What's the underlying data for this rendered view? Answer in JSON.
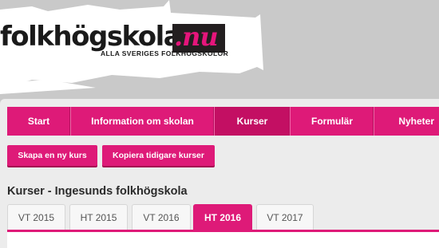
{
  "logo": {
    "name_main": "folkhögskola",
    "name_suffix": ".nu",
    "tagline": "ALLA SVERIGES FOLKHÖGSKOLOR"
  },
  "nav": {
    "items": [
      {
        "label": "Start",
        "active": false
      },
      {
        "label": "Information om skolan",
        "active": false
      },
      {
        "label": "Kurser",
        "active": true
      },
      {
        "label": "Formulär",
        "active": false
      },
      {
        "label": "Nyheter",
        "active": false
      }
    ]
  },
  "actions": {
    "create_label": "Skapa en ny kurs",
    "copy_label": "Kopiera tidigare kurser"
  },
  "page": {
    "title": "Kurser - Ingesunds folkhögskola"
  },
  "tabs": [
    {
      "label": "VT 2015",
      "active": false
    },
    {
      "label": "HT 2015",
      "active": false
    },
    {
      "label": "VT 2016",
      "active": false
    },
    {
      "label": "HT 2016",
      "active": true
    },
    {
      "label": "VT 2017",
      "active": false
    }
  ],
  "colors": {
    "accent": "#de1a78",
    "accent_dark": "#c30f63",
    "header_bg": "#c9c9c9",
    "panel_bg": "#ececec"
  }
}
